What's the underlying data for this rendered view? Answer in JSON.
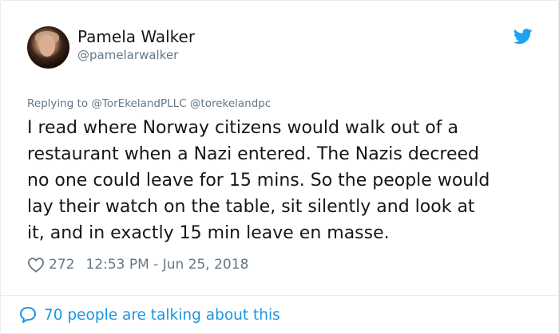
{
  "author": {
    "name": "Pamela Walker",
    "handle": "@pamelarwalker"
  },
  "reply": {
    "prefix": "Replying to",
    "mentions": [
      "@TorEkelandPLLC",
      "@torekelandpc"
    ]
  },
  "tweet": {
    "lines": [
      "I read where Norway citizens would walk out of a",
      "restaurant when a Nazi entered. The Nazis decreed",
      "no one could leave for 15 mins. So the people would",
      "lay their watch on the table, sit silently and look at",
      "it, and in exactly 15 min leave en masse."
    ]
  },
  "meta": {
    "likes": "272",
    "timestamp": "12:53 PM - Jun 25, 2018"
  },
  "conversation": {
    "label": "70 people are talking about this"
  },
  "icons": {
    "brand": "twitter-bird-icon",
    "like": "heart-icon",
    "comment": "speech-bubble-icon"
  },
  "colors": {
    "brand_blue": "#1da1f2",
    "link_blue": "#1b95e0",
    "text": "#14171a",
    "muted": "#657786"
  }
}
